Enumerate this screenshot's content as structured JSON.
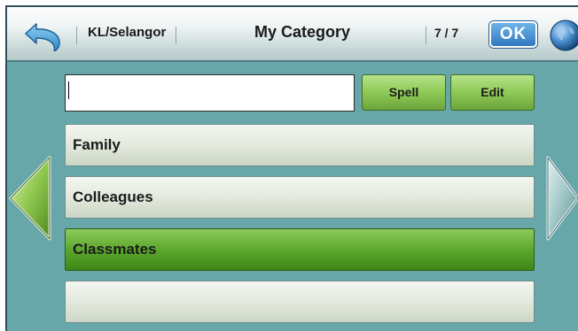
{
  "header": {
    "region": "KL/Selangor",
    "title": "My Category",
    "page_indicator": "7 / 7",
    "ok_label": "OK"
  },
  "search": {
    "value": "",
    "spell_label": "Spell",
    "edit_label": "Edit"
  },
  "list": {
    "items": [
      {
        "label": "Family",
        "selected": false
      },
      {
        "label": "Colleagues",
        "selected": false
      },
      {
        "label": "Classmates",
        "selected": true
      },
      {
        "label": "",
        "selected": false
      }
    ]
  },
  "icons": {
    "back": "undo-arrow-icon",
    "globe": "globe-icon",
    "prev": "left-arrow-icon",
    "next": "right-arrow-icon"
  },
  "colors": {
    "background": "#67a7a9",
    "selected": "#5da82e",
    "ok_button": "#2f78c2"
  }
}
